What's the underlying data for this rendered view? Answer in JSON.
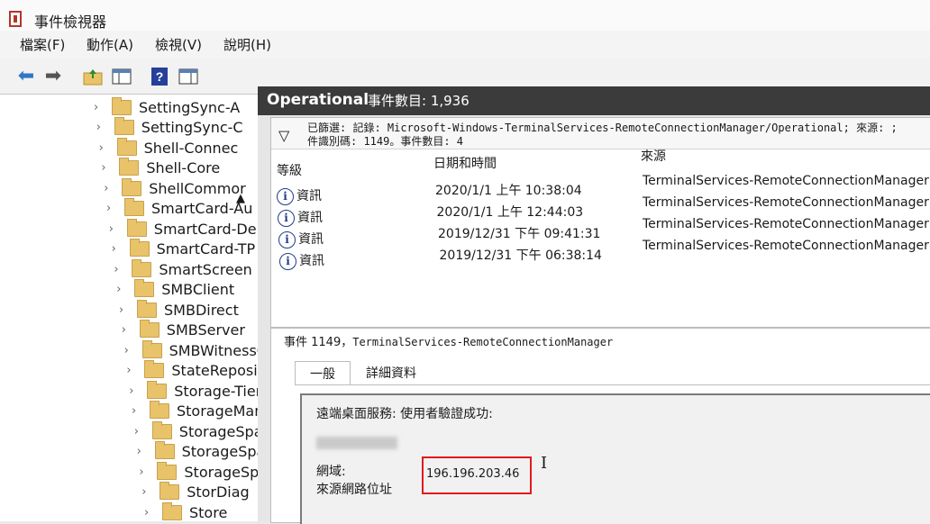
{
  "window": {
    "title": "事件檢視器"
  },
  "menu": [
    "檔案(F)",
    "動作(A)",
    "檢視(V)",
    "說明(H)"
  ],
  "toolbar_icons": [
    "back-arrow-icon",
    "forward-arrow-icon",
    "folder-up-icon",
    "console-tree-icon",
    "help-icon",
    "properties-icon"
  ],
  "tree": {
    "items": [
      "SettingSync-A",
      "SettingSync-C",
      "Shell-Connec",
      "Shell-Core",
      "ShellCommor",
      "SmartCard-Au",
      "SmartCard-De",
      "SmartCard-TP",
      "SmartScreen",
      "SMBClient",
      "SMBDirect",
      "SMBServer",
      "SMBWitnessC",
      "StateReposito",
      "Storage-Tierii",
      "StorageMana",
      "StorageSpace",
      "StorageSpace",
      "StorageSpace",
      "StorDiag",
      "Store"
    ]
  },
  "log_header": {
    "name": "Operational",
    "count": "事件數目: 1,936"
  },
  "filter": {
    "line1": "已篩選: 記錄: Microsoft-Windows-TerminalServices-RemoteConnectionManager/Operational; 來源: ;",
    "line2": "件識別碼: 1149。事件數目: 4"
  },
  "columns": {
    "level": "等級",
    "datetime": "日期和時間",
    "source": "來源"
  },
  "events": [
    {
      "level": "資訊",
      "datetime": "2020/1/1 上午 10:38:04",
      "source": "TerminalServices-RemoteConnectionManager"
    },
    {
      "level": "資訊",
      "datetime": "2020/1/1 上午 12:44:03",
      "source": "TerminalServices-RemoteConnectionManager"
    },
    {
      "level": "資訊",
      "datetime": "2019/12/31 下午 09:41:31",
      "source": "TerminalServices-RemoteConnectionManager"
    },
    {
      "level": "資訊",
      "datetime": "2019/12/31 下午 06:38:14",
      "source": "TerminalServices-RemoteConnectionManager"
    }
  ],
  "detail": {
    "title_prefix": "事件 1149，",
    "title_source": "TerminalServices-RemoteConnectionManager",
    "tabs": [
      "一般",
      "詳細資料"
    ],
    "message": "遠端桌面服務: 使用者驗證成功:",
    "domain_label": "網域:",
    "source_ip_label": "來源網路位址",
    "source_ip": "196.196.203.46"
  },
  "colors": {
    "highlight_box": "#e01b1b",
    "header_bg": "#3b3b3b",
    "folder": "#e9c36a"
  }
}
